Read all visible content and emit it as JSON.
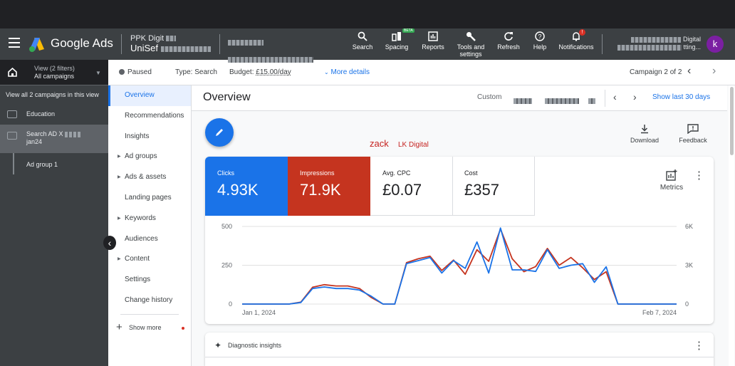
{
  "app": {
    "name": "Google Ads",
    "account_line1": "PPK Digit",
    "account_line2": "UniSef",
    "right_account_line1": "Digital",
    "right_account_line2": "tting...",
    "avatar_letter": "k"
  },
  "toolbar": {
    "search": "Search",
    "spacing": "Spacing",
    "spacing_badge": "BETA",
    "reports": "Reports",
    "tools_line1": "Tools and",
    "tools_line2": "settings",
    "refresh": "Refresh",
    "help": "Help",
    "notifications": "Notifications",
    "notification_badge": "!"
  },
  "leftnav": {
    "view_line1": "View (2 filters)",
    "view_line2": "All campaigns",
    "all_campaigns": "View all 2 campaigns in this view",
    "items": [
      {
        "label": "Education"
      },
      {
        "label_line1": "Search AD X",
        "label_line2": "jan24"
      }
    ],
    "subitem": "Ad group 1"
  },
  "subbar": {
    "status": "Paused",
    "type": "Type: Search",
    "budget_label": "Budget:",
    "budget_value": "£15.00/day",
    "more_details": "More details",
    "campaign_position": "Campaign 2 of 2"
  },
  "secnav": {
    "items": [
      "Overview",
      "Recommendations",
      "Insights",
      "Ad groups",
      "Ads & assets",
      "Landing pages",
      "Keywords",
      "Audiences",
      "Content",
      "Settings",
      "Change history"
    ],
    "expandable": [
      false,
      false,
      false,
      true,
      true,
      false,
      true,
      false,
      true,
      false,
      false
    ],
    "show_more": "Show more"
  },
  "main": {
    "title": "Overview",
    "date_mode": "Custom",
    "show_last": "Show last 30 days",
    "annotation_name": "zack",
    "annotation_org": "LK Digital",
    "download": "Download",
    "feedback": "Feedback",
    "diagnostic": "Diagnostic insights"
  },
  "tiles": [
    {
      "label": "Clicks",
      "value": "4.93K"
    },
    {
      "label": "Impressions",
      "value": "71.9K"
    },
    {
      "label": "Avg. CPC",
      "value": "£0.07"
    },
    {
      "label": "Cost",
      "value": "£357"
    }
  ],
  "metrics_label": "Metrics",
  "colors": {
    "clicks": "#1a73e8",
    "impressions": "#c5341f"
  },
  "chart_data": {
    "type": "line",
    "x_start_label": "Jan 1, 2024",
    "x_end_label": "Feb 7, 2024",
    "left_axis": {
      "ticks": [
        "0",
        "250",
        "500"
      ],
      "range": [
        0,
        500
      ]
    },
    "right_axis": {
      "ticks": [
        "0",
        "3K",
        "6K"
      ],
      "range": [
        0,
        6000
      ]
    },
    "series": [
      {
        "name": "Clicks",
        "axis": "left",
        "values": [
          0,
          0,
          0,
          0,
          0,
          10,
          100,
          110,
          100,
          100,
          90,
          50,
          0,
          0,
          260,
          280,
          300,
          200,
          280,
          230,
          400,
          200,
          490,
          220,
          220,
          210,
          350,
          230,
          250,
          260,
          140,
          240,
          0,
          0,
          0,
          0,
          0,
          0
        ]
      },
      {
        "name": "Impressions",
        "axis": "right",
        "values": [
          0,
          0,
          0,
          0,
          0,
          150,
          1300,
          1500,
          1400,
          1400,
          1200,
          500,
          0,
          0,
          3200,
          3500,
          3700,
          2600,
          3400,
          2300,
          4200,
          3300,
          5800,
          3500,
          2500,
          2900,
          4300,
          3000,
          3600,
          2800,
          1900,
          2500,
          0,
          0,
          0,
          0,
          0,
          0
        ]
      }
    ]
  }
}
